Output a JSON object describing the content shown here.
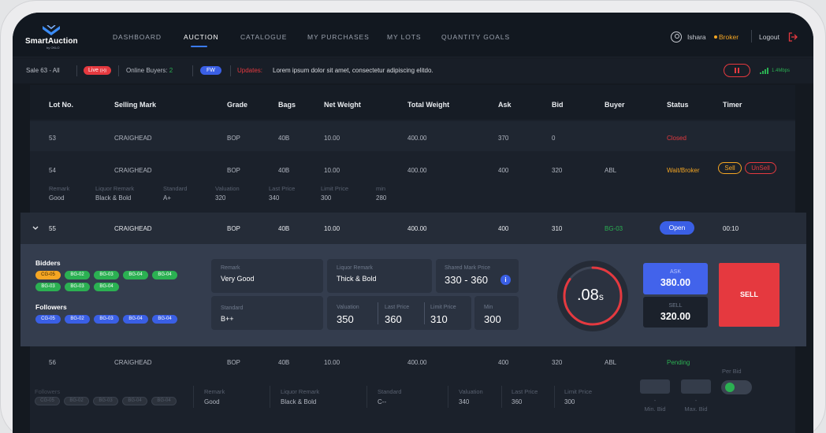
{
  "nav": {
    "brand": "SmartAuction",
    "brand_sub": "by OKLO",
    "items": [
      "DASHBOARD",
      "AUCTION",
      "CATALOGUE",
      "MY PURCHASES",
      "MY LOTS",
      "QUANTITY GOALS"
    ],
    "user": "Ishara",
    "role": "Broker",
    "logout": "Logout"
  },
  "subbar": {
    "sale": "Sale 63 - All",
    "live": "Live",
    "online_label": "Online Buyers:",
    "online_count": "2",
    "fw": "FW",
    "updates_label": "Updates:",
    "updates_text": "Lorem ipsum dolor sit amet, consectetur adipiscing elitdo.",
    "speed": "1.4Mbps"
  },
  "columns": [
    "Lot No.",
    "Selling Mark",
    "Grade",
    "Bags",
    "Net Weight",
    "Total Weight",
    "Ask",
    "Bid",
    "Buyer",
    "Status",
    "Timer"
  ],
  "rows": [
    {
      "lot": "53",
      "mark": "CRAIGHEAD",
      "grade": "BOP",
      "bags": "40B",
      "net": "10.00",
      "total": "400.00",
      "ask": "370",
      "bid": "0",
      "buyer": "",
      "status": "Closed"
    },
    {
      "lot": "54",
      "mark": "CRAIGHEAD",
      "grade": "BOP",
      "bags": "40B",
      "net": "10.00",
      "total": "400.00",
      "ask": "400",
      "bid": "320",
      "buyer": "ABL",
      "status": "Wait/Broker",
      "sell": "Sell",
      "unsell": "UnSell",
      "detail_labels": [
        "Remark",
        "Liquor Remark",
        "Standard",
        "Valuation",
        "Last Price",
        "Limit Price",
        "min"
      ],
      "detail_values": [
        "Good",
        "Black & Bold",
        "A+",
        "320",
        "340",
        "300",
        "280"
      ]
    },
    {
      "lot": "55",
      "mark": "CRAIGHEAD",
      "grade": "BOP",
      "bags": "40B",
      "net": "10.00",
      "total": "400.00",
      "ask": "400",
      "bid": "310",
      "buyer": "BG-03",
      "status": "Open",
      "timer": "00:10"
    },
    {
      "lot": "56",
      "mark": "CRAIGHEAD",
      "grade": "BOP",
      "bags": "40B",
      "net": "10.00",
      "total": "400.00",
      "ask": "400",
      "bid": "320",
      "buyer": "ABL",
      "status": "Pending"
    }
  ],
  "panel": {
    "bidders_label": "Bidders",
    "bidders": [
      "CG-05",
      "BG-02",
      "BG-03",
      "BG-04",
      "BG-04",
      "BG-03",
      "BG-04",
      "BG-03"
    ],
    "followers_label": "Followers",
    "followers": [
      "CG-05",
      "BG-02",
      "BG-03",
      "BG-04",
      "BG-04"
    ],
    "remark_label": "Remark",
    "remark": "Very Good",
    "liquor_label": "Liquor Remark",
    "liquor": "Thick & Bold",
    "shared_label": "Shared Mark Price",
    "shared": "330 - 360",
    "standard_label": "Standard",
    "standard": "B++",
    "valuation_label": "Valuation",
    "valuation": "350",
    "last_label": "Last Price",
    "last": "360",
    "limit_label": "Limit Price",
    "limit": "310",
    "min_label": "Min",
    "min": "300",
    "timer": ".08",
    "timer_unit": "s",
    "timer_fraction": 0.85,
    "ask_label": "ASK",
    "ask": "380.00",
    "sell_label": "SELL",
    "sell": "320.00",
    "sell_button": "SELL"
  },
  "row56": {
    "followers_label": "Followers",
    "followers": [
      "CG-05",
      "BG-02",
      "BG-03",
      "BG-04",
      "BG-04"
    ],
    "labels": [
      "Remark",
      "Liquor Remark",
      "Standard",
      "Valuation",
      "Last Price",
      "Limit Price"
    ],
    "values": [
      "Good",
      "Black & Bold",
      "C--",
      "340",
      "360",
      "300"
    ],
    "per_bid": "Per Bid",
    "min_bid": "Min. Bid",
    "max_bid": "Max. Bid",
    "dash": "-"
  },
  "colors": {
    "accent": "#3b7cf6",
    "danger": "#e5393f",
    "success": "#2bb052",
    "warning": "#f5a623"
  }
}
